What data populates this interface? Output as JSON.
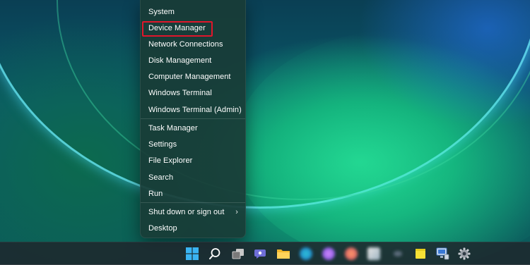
{
  "context_menu": {
    "items": [
      {
        "label": "System"
      },
      {
        "label": "Device Manager"
      },
      {
        "label": "Network Connections"
      },
      {
        "label": "Disk Management"
      },
      {
        "label": "Computer Management"
      },
      {
        "label": "Windows Terminal"
      },
      {
        "label": "Windows Terminal (Admin)"
      },
      {
        "label": "Task Manager"
      },
      {
        "label": "Settings"
      },
      {
        "label": "File Explorer"
      },
      {
        "label": "Search"
      },
      {
        "label": "Run"
      },
      {
        "label": "Shut down or sign out",
        "submenu_arrow": "›"
      },
      {
        "label": "Desktop"
      }
    ],
    "highlighted_item": "Device Manager",
    "highlight_color": "#e0162b"
  },
  "taskbar": {
    "icons": [
      "windows-start-icon",
      "search-icon",
      "task-view-icon",
      "teams-chat-icon",
      "file-explorer-icon",
      "blurred-app-icon",
      "blurred-app-icon",
      "blurred-app-icon",
      "blurred-app-icon",
      "blurred-app-icon",
      "sticky-notes-icon",
      "computer-app-icon",
      "settings-icon"
    ]
  }
}
